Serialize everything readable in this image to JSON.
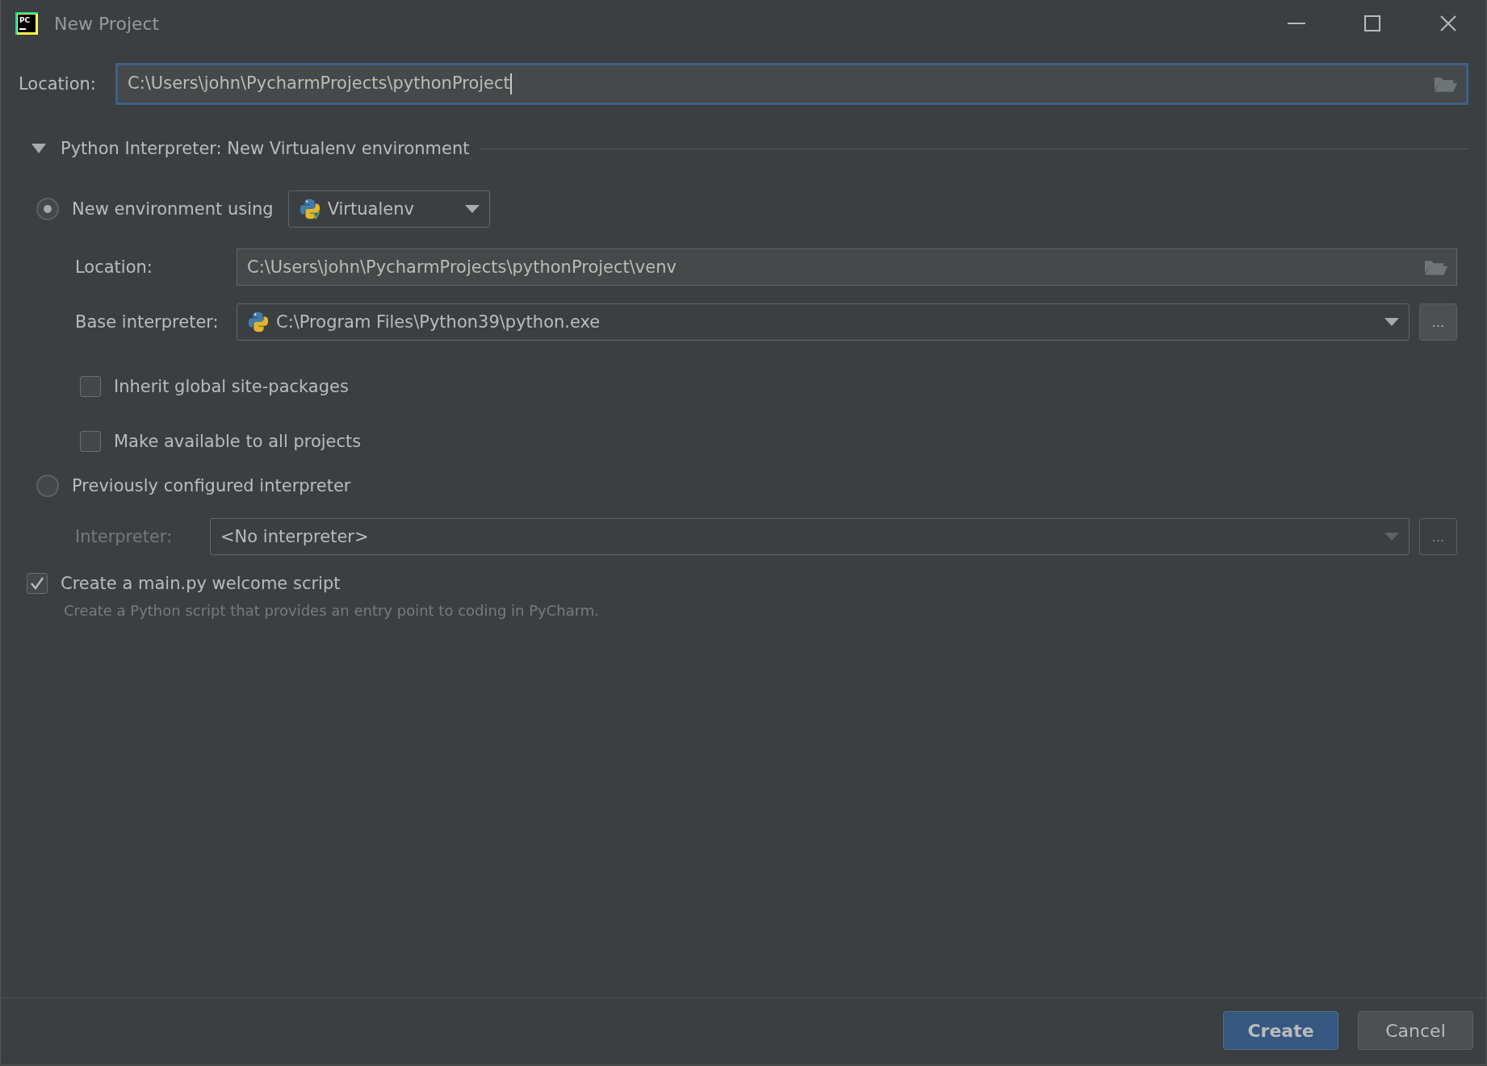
{
  "window": {
    "title": "New Project",
    "logo_text": "PC"
  },
  "location": {
    "label": "Location:",
    "value": "C:\\Users\\john\\PycharmProjects\\pythonProject",
    "focused": true
  },
  "interpreter_section": {
    "title": "Python Interpreter: New Virtualenv environment",
    "expanded": true,
    "new_environment": {
      "label": "New environment using",
      "selected": true,
      "tool": "Virtualenv",
      "location": {
        "label": "Location:",
        "value": "C:\\Users\\john\\PycharmProjects\\pythonProject\\venv"
      },
      "base_interpreter": {
        "label": "Base interpreter:",
        "value": "C:\\Program Files\\Python39\\python.exe",
        "browse": "..."
      },
      "options": [
        {
          "label": "Inherit global site-packages",
          "checked": false
        },
        {
          "label": "Make available to all projects",
          "checked": false
        }
      ]
    },
    "previous_interpreter": {
      "label": "Previously configured interpreter",
      "selected": false,
      "interpreter": {
        "label": "Interpreter:",
        "value": "<No interpreter>",
        "disabled": true,
        "browse": "..."
      }
    }
  },
  "welcome_script": {
    "label": "Create a main.py welcome script",
    "checked": true,
    "hint": "Create a Python script that provides an entry point to coding in PyCharm."
  },
  "buttons": [
    {
      "label": "Create",
      "kind": "primary"
    },
    {
      "label": "Cancel",
      "kind": "secondary"
    }
  ]
}
